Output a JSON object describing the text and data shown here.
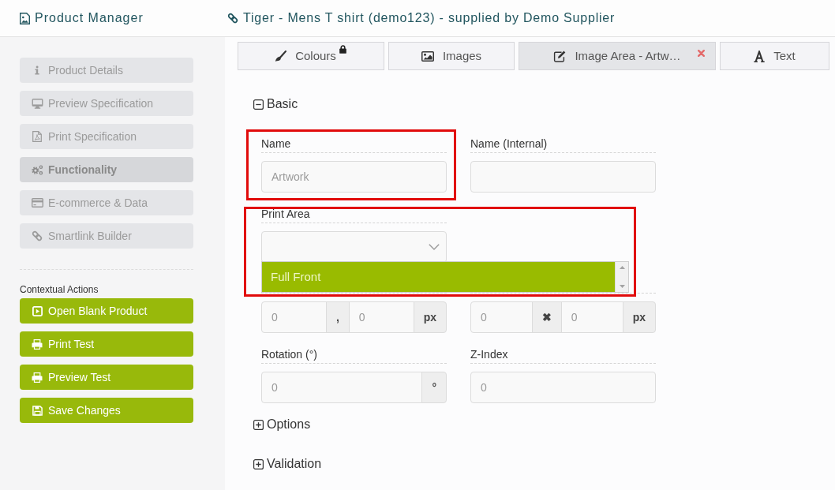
{
  "header": {
    "app_title": "Product Manager",
    "product_title": "Tiger - Mens T shirt (demo123) - supplied by Demo Supplier"
  },
  "sidebar": {
    "items": [
      {
        "label": "Product Details",
        "selected": false
      },
      {
        "label": "Preview Specification",
        "selected": false
      },
      {
        "label": "Print Specification",
        "selected": false
      },
      {
        "label": "Functionality",
        "selected": true
      },
      {
        "label": "E-commerce & Data",
        "selected": false
      },
      {
        "label": "Smartlink Builder",
        "selected": false
      }
    ],
    "contextual_actions": {
      "heading": "Contextual Actions",
      "buttons": [
        "Open Blank Product",
        "Print Test",
        "Preview Test",
        "Save Changes"
      ]
    }
  },
  "tabs": [
    {
      "label": "Colours",
      "selected": false,
      "locked": true,
      "closable": false
    },
    {
      "label": "Images",
      "selected": false,
      "locked": false,
      "closable": false
    },
    {
      "label": "Image Area - Artw…",
      "selected": true,
      "locked": false,
      "closable": true
    },
    {
      "label": "Text",
      "selected": false,
      "locked": false,
      "closable": false
    }
  ],
  "sections": [
    {
      "title": "Basic",
      "expanded": true,
      "rows": [
        [
          {
            "kind": "text",
            "label": "Name",
            "placeholder": "Artwork",
            "highlighted": true
          },
          {
            "kind": "text",
            "label": "Name (Internal)",
            "highlighted": false
          }
        ],
        [
          {
            "kind": "select",
            "label": "Print Area",
            "expanded": true,
            "highlighted": true,
            "options": [
              {
                "label": "Full Front",
                "selected": true
              }
            ]
          }
        ],
        [
          {
            "kind": "pair",
            "inputs": [
              {
                "placeholder": "0"
              },
              {
                "placeholder": "0"
              }
            ],
            "separator": ",",
            "unit": "px",
            "highlighted": false
          },
          {
            "kind": "pair",
            "inputs": [
              {
                "placeholder": "0"
              },
              {
                "placeholder": "0"
              }
            ],
            "separator": "✖",
            "unit": "px",
            "highlighted": false
          }
        ],
        [
          {
            "kind": "addon",
            "label": "Rotation (°)",
            "placeholder": "0",
            "unit": "°",
            "highlighted": false
          },
          {
            "kind": "text",
            "label": "Z-Index",
            "placeholder": "0",
            "highlighted": false
          }
        ]
      ]
    },
    {
      "title": "Options",
      "expanded": false
    },
    {
      "title": "Validation",
      "expanded": false
    }
  ]
}
